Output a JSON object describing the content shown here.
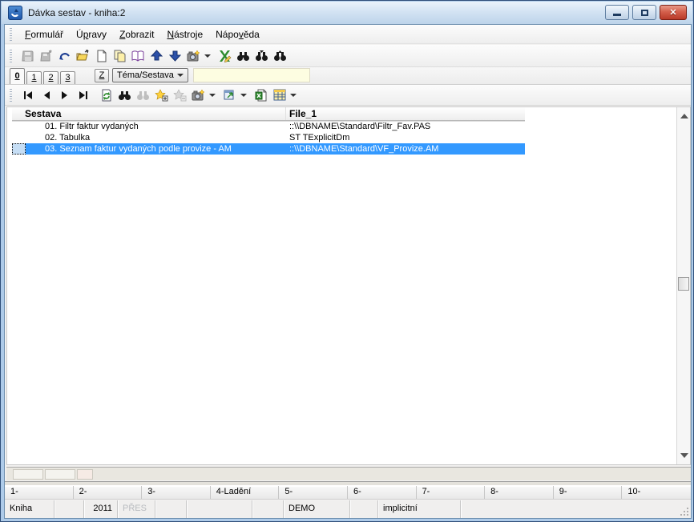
{
  "window": {
    "title": "Dávka sestav - kniha:2"
  },
  "titlebar": {
    "buttons": [
      "minimize",
      "maximize",
      "close"
    ]
  },
  "menubar": {
    "items": [
      {
        "pre": "",
        "key": "F",
        "post": "ormulář"
      },
      {
        "pre": "Ú",
        "key": "p",
        "post": "ravy"
      },
      {
        "pre": "",
        "key": "Z",
        "post": "obrazit"
      },
      {
        "pre": "",
        "key": "N",
        "post": "ástroje"
      },
      {
        "pre": "Nápo",
        "key": "v",
        "post": "ěda"
      }
    ]
  },
  "toolbar_main": {
    "icons": [
      "save-icon",
      "save-as-icon",
      "undo-icon",
      "open-folder-icon",
      "new-document-icon",
      "copy-icon",
      "book-icon",
      "move-up-icon",
      "move-down-icon",
      "camera-icon",
      "excel-edit-icon",
      "find-icon",
      "find-next-icon",
      "find-previous-icon"
    ]
  },
  "toolbar_grid": {
    "icons": [
      "first-record-icon",
      "previous-record-icon",
      "next-record-icon",
      "last-record-icon",
      "refresh-icon",
      "find-icon",
      "find-again-icon",
      "add-record-icon",
      "delete-record-icon",
      "camera-icon",
      "export-icon",
      "excel-icon",
      "table-view-icon"
    ]
  },
  "tabbar": {
    "tabs": [
      "0",
      "1",
      "2",
      "3"
    ],
    "z_button": "Z",
    "selector_label": "Téma/Sestava",
    "filter_value": ""
  },
  "grid": {
    "columns": {
      "col1": "Sestava",
      "col2": "File_1"
    },
    "rows": [
      {
        "sestava": "01. Filtr faktur vydaných",
        "file": "::\\\\DBNAME\\Standard\\Filtr_Fav.PAS",
        "selected": false
      },
      {
        "sestava": "02. Tabulka",
        "file": "ST TExplicitDm",
        "selected": false
      },
      {
        "sestava": "03. Seznam faktur vydaných podle provize - AM",
        "file": "::\\\\DBNAME\\Standard\\VF_Provize.AM",
        "selected": true
      }
    ]
  },
  "function_bar": {
    "keys": [
      "1-",
      "2-",
      "3-",
      "4-Ladění",
      "5-",
      "6-",
      "7-",
      "8-",
      "9-",
      "10-"
    ]
  },
  "status_bar": {
    "cells": [
      "Kniha",
      "",
      "2011",
      "PŘES",
      "",
      "",
      "DEMO",
      "",
      "implicitní",
      ""
    ]
  },
  "colors": {
    "selection": "#3399ff",
    "field_yellow": "#fdfde1",
    "close_button_red": "#c24434"
  }
}
